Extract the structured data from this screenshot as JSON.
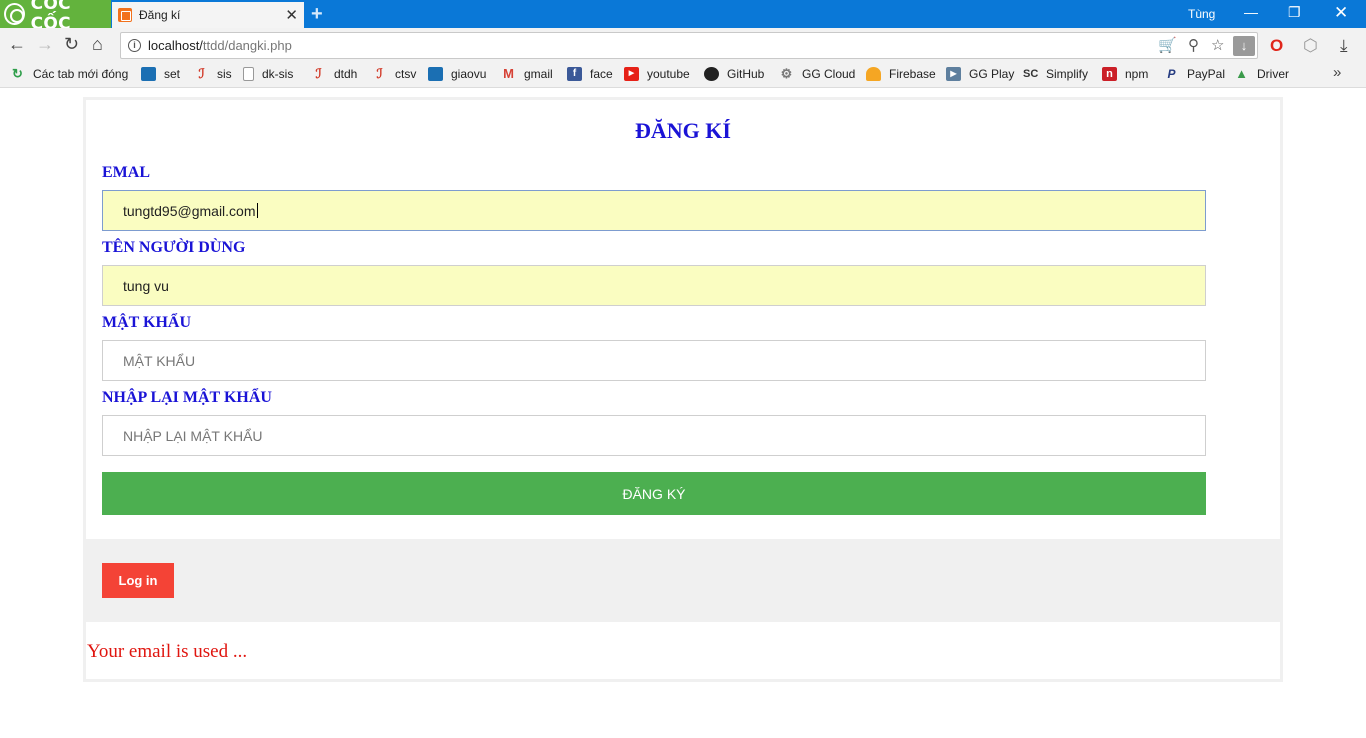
{
  "browser": {
    "brand": "CỐC CỐC",
    "tab_title": "Đăng kí",
    "tab_close": "✕",
    "new_tab": "+",
    "user": "Tùng",
    "url_host": "localhost/",
    "url_path": "ttdd/dangki.php",
    "bookmarks": [
      {
        "label": "Các tab mới đóng",
        "icon": "recent-tabs-icon",
        "color": "#2e9e4a"
      },
      {
        "label": "set",
        "icon": "set-icon",
        "color": "#1b6fb3"
      },
      {
        "label": "sis",
        "icon": "sis-icon",
        "color": "#d23b2a"
      },
      {
        "label": "dk-sis",
        "icon": "page-icon",
        "color": "#ffffff"
      },
      {
        "label": "dtdh",
        "icon": "dtdh-icon",
        "color": "#d23b2a"
      },
      {
        "label": "ctsv",
        "icon": "ctsv-icon",
        "color": "#d23b2a"
      },
      {
        "label": "giaovu",
        "icon": "giaovu-icon",
        "color": "#1b6fb3"
      },
      {
        "label": "gmail",
        "icon": "gmail-icon",
        "color": "#d64236"
      },
      {
        "label": "face",
        "icon": "facebook-icon",
        "color": "#3b5998"
      },
      {
        "label": "youtube",
        "icon": "youtube-icon",
        "color": "#e62117"
      },
      {
        "label": "GitHub",
        "icon": "github-icon",
        "color": "#222222"
      },
      {
        "label": "GG Cloud",
        "icon": "gg-cloud-icon",
        "color": "#777777"
      },
      {
        "label": "Firebase",
        "icon": "firebase-icon",
        "color": "#f5a623"
      },
      {
        "label": "GG Play",
        "icon": "gg-play-icon",
        "color": "#5e7f9e"
      },
      {
        "label": "Simplify",
        "icon": "simplify-icon",
        "color": "#333333"
      },
      {
        "label": "npm",
        "icon": "npm-icon",
        "color": "#cb1f27"
      },
      {
        "label": "PayPal",
        "icon": "paypal-icon",
        "color": "#253b80"
      },
      {
        "label": "Driver",
        "icon": "drive-icon",
        "color": "#3a9a4a"
      }
    ]
  },
  "form": {
    "title": "ĐĂNG KÍ",
    "email_label": "EMAL",
    "email_value": "tungtd95@gmail.com",
    "username_label": "TÊN NGƯỜI DÙNG",
    "username_value": "tung vu",
    "password_label": "MẬT KHẨU",
    "password_placeholder": "MẬT KHẨU",
    "confirm_label": "NHẬP LẠI MẬT KHẨU",
    "confirm_placeholder": "NHẬP LẠI MẬT KHẨU",
    "submit_label": "ĐĂNG KÝ"
  },
  "footer": {
    "login_label": "Log in"
  },
  "error_message": "Your email is used ..."
}
